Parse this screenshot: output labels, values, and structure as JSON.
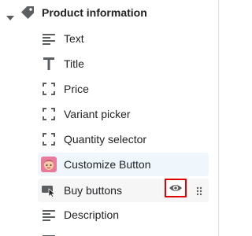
{
  "section": {
    "title": "Product information",
    "icons": {
      "collapse": "chevron-down-icon",
      "section": "tag-icon"
    }
  },
  "blocks": [
    {
      "label": "Text",
      "icon": "text-lines-icon"
    },
    {
      "label": "Title",
      "icon": "title-t-icon"
    },
    {
      "label": "Price",
      "icon": "dashed-square-icon"
    },
    {
      "label": "Variant picker",
      "icon": "dashed-square-icon"
    },
    {
      "label": "Quantity selector",
      "icon": "dashed-square-icon"
    },
    {
      "label": "Customize Button",
      "icon": "app-avatar-icon",
      "highlight": "selected"
    },
    {
      "label": "Buy buttons",
      "icon": "buy-button-icon",
      "highlight": "hover",
      "actions": [
        "eye-icon",
        "drag-handle-icon"
      ]
    },
    {
      "label": "Description",
      "icon": "text-lines-icon"
    }
  ],
  "colors": {
    "selected_bg": "#f0f7fc",
    "hover_bg": "#f6f6f7",
    "annotation": "#e00000",
    "icon": "#5c5f62"
  }
}
